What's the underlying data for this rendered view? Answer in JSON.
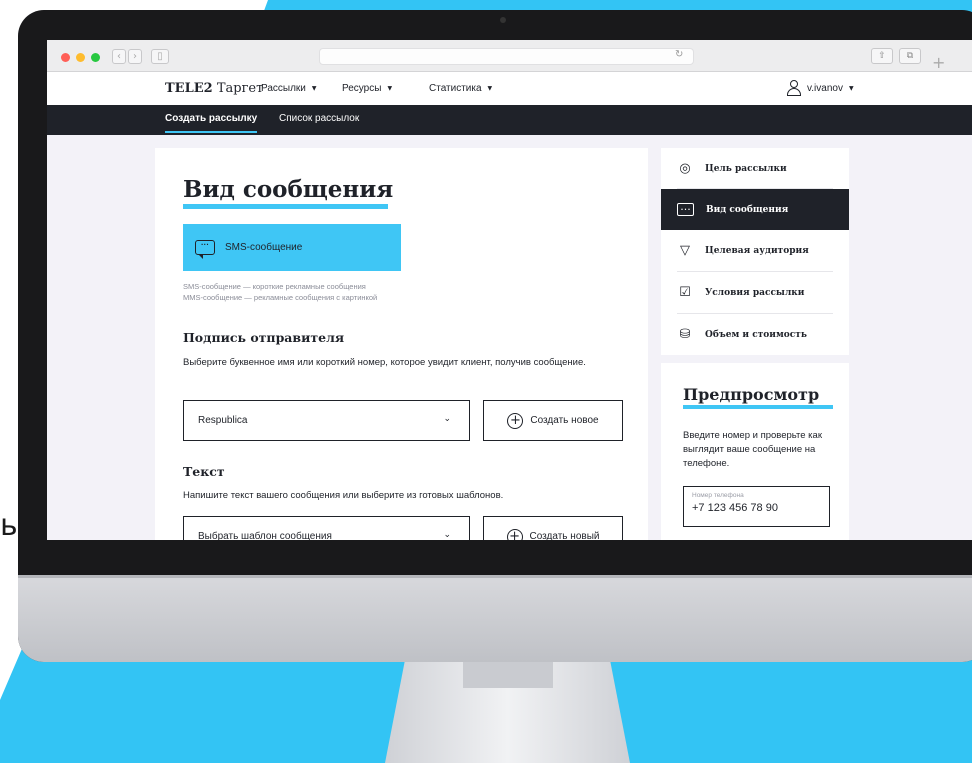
{
  "colors": {
    "accent": "#3fc6f5",
    "dark": "#1f2229",
    "page_bg": "#f3f2f8"
  },
  "partial_text": "ь",
  "header": {
    "brand": "TELE2",
    "brand_suffix": "Таргет",
    "nav": [
      {
        "label": "Рассылки"
      },
      {
        "label": "Ресурсы"
      },
      {
        "label": "Статистика"
      }
    ],
    "username": "v.ivanov"
  },
  "subnav": {
    "tabs": [
      {
        "label": "Создать рассылку",
        "active": true
      },
      {
        "label": "Список рассылок",
        "active": false
      }
    ]
  },
  "main": {
    "title": "Вид сообщения",
    "message_type_button": "SMS-сообщение",
    "hint_sms": "SMS-сообщение — короткие рекламные сообщения",
    "hint_mms": "MMS-сообщение — рекламные сообщения с картинкой",
    "sender": {
      "title": "Подпись отправителя",
      "description": "Выберите буквенное имя или короткий номер, которое увидит клиент, получив сообщение.",
      "selected": "Respublica",
      "create_label": "Создать новое"
    },
    "text": {
      "title": "Текст",
      "description": "Напишите текст вашего сообщения или выберите из готовых шаблонов.",
      "template_placeholder": "Выбрать шаблон сообщения",
      "create_label": "Создать новый"
    }
  },
  "steps": [
    {
      "label": "Цель рассылки",
      "icon": "target-icon",
      "active": false
    },
    {
      "label": "Вид сообщения",
      "icon": "chat-icon",
      "active": true
    },
    {
      "label": "Целевая аудитория",
      "icon": "filter-icon",
      "active": false
    },
    {
      "label": "Условия рассылки",
      "icon": "checklist-icon",
      "active": false
    },
    {
      "label": "Объем и стоимость",
      "icon": "coins-icon",
      "active": false
    }
  ],
  "preview": {
    "title": "Предпросмотр",
    "text": "Введите номер и проверьте как выглядит ваше сообщение на телефоне.",
    "phone_label": "Номер телефона",
    "phone_value": "+7 123 456 78 90"
  }
}
